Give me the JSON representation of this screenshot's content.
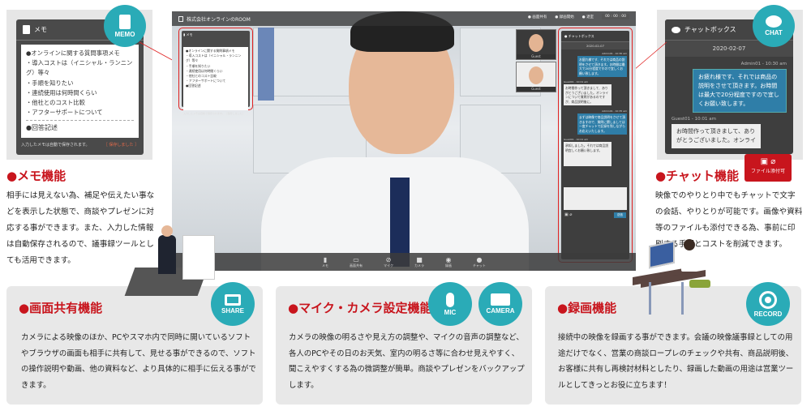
{
  "memo_panel": {
    "header": "メモ",
    "badge": "MEMO",
    "lines": [
      "●オンラインに関する質問事項メモ",
      "・導入コストは（イニシャル・ランニング）等々",
      "・手順を知りたい",
      "・連続使用は何時間くらい",
      "・他社とのコスト比較",
      "・アフターサポートについて"
    ],
    "answer_heading": "●回答記述",
    "autosave_note": "入力したメモは自動で保存されます。",
    "saved_status": "［ 保存しました ］"
  },
  "memo_feature": {
    "title": "●メモ機能",
    "text": "相手には見えない為、補足や伝えたい事などを表示した状態で、商談やプレゼンに対応する事ができます。また、入力した情報は自動保存されるので、議事録ツールとしても活用できます。"
  },
  "chat_panel": {
    "header": "チャットボックス",
    "badge": "CHAT",
    "date": "2020-02-07",
    "messages": [
      {
        "sender": "Admin01",
        "time": "10:30 am",
        "role": "admin",
        "text": "お疲れ様です、それでは商品の説明をさせて頂きます。お時間は最大で20分程度ですので宜しくお願い致します。"
      },
      {
        "sender": "Guest01",
        "time": "10:01 am",
        "role": "guest",
        "text": "お時間作って頂きまして、ありがとうございました。オンライ"
      }
    ]
  },
  "chat_feature": {
    "title": "●チャット機能",
    "file_badge": "ファイル添付可",
    "text": "映像でのやりとり中でもチャットで文字の会話、やりとりが可能です。画像や資料等のファイルも添付できる為、事前に印刷する手間とコストを削減できます。"
  },
  "video_app": {
    "title": "株式会社オンラインのROOM",
    "top_controls": [
      "画面共有",
      "録画開始",
      "退室",
      "00 : 00 : 00"
    ],
    "thumbnails": [
      {
        "label": "Guest"
      },
      {
        "label": "Guest"
      }
    ],
    "toolbar": [
      {
        "icon": "memo-icon",
        "label": "メモ"
      },
      {
        "icon": "screen-share-icon",
        "label": "画面共有"
      },
      {
        "icon": "mic-off-icon",
        "label": "マイク"
      },
      {
        "icon": "camera-icon",
        "label": "カメラ"
      },
      {
        "icon": "record-icon",
        "label": "録画"
      },
      {
        "icon": "chat-icon",
        "label": "チャット"
      }
    ],
    "mini_memo": {
      "header": "メモ",
      "lines": [
        "●オンラインに関する質問事項メモ",
        "・導入コストは（イニシャル・ランニング）等々",
        "・手順を知りたい",
        "・連続使用は何時間くらい",
        "・他社とのコスト比較",
        "・アフターサポートについて",
        "●回答記述"
      ],
      "footer": "入力したメモは自動で保存されます。 ［保存しました］"
    },
    "mini_chat": {
      "header": "チャットボックス",
      "date": "2020-02-07",
      "messages": [
        {
          "meta": "Admin01 - 10:30 am",
          "role": "admin",
          "text": "お疲れ様です、それでは商品の説明をさせて頂きます。お時間は最大で20分程度ですので宜しくお願い致します。"
        },
        {
          "meta": "Guest01 - 10:01 am",
          "role": "guest",
          "text": "お時間作って頂きまして、ありがとうございました。オンラインについて質問があるのですが、商品説明後に。"
        },
        {
          "meta": "Admin01 - 10:35 am",
          "role": "admin",
          "text": "まずは映像で商品説明をさせて頂きますので、質問に関しましては一度チャットで記録を残しながらお応えいたします。"
        },
        {
          "meta": "Guest01 - 10:01 am",
          "role": "guest",
          "text": "承知しました。それでは商品説明宜しくお願い致します。"
        }
      ],
      "send_label": "送信"
    }
  },
  "share_feature": {
    "title": "●画面共有機能",
    "badge": "SHARE",
    "text": "カメラによる映像のほか、PCやスマホ内で同時に開いているソフトやブラウザの画面も相手に共有して、見せる事ができるので、ソフトの操作説明や動画、他の資料など、より具体的に相手に伝える事ができます。"
  },
  "mic_camera_feature": {
    "title": "●マイク・カメラ設定機能",
    "badges": [
      "MIC",
      "CAMERA"
    ],
    "text": "カメラの映像の明るさや見え方の調整や、マイクの音声の調整など、各人のPCやその日のお天気、室内の明るさ等に合わせ見えやすく、聞こえやすくする為の微調整が簡単。商談やプレゼンをバックアップします。"
  },
  "record_feature": {
    "title": "●録画機能",
    "badge": "RECORD",
    "text": "接続中の映像を録画する事ができます。会議の映像議事録としての用途だけでなく、営業の商談ロープレのチェックや共有、商品説明後、お客様に共有し再検討材料としたり、録画した動画の用途は営業ツールとしてきっとお役に立ちます！"
  },
  "colors": {
    "accent_red": "#c8151d",
    "teal": "#2aabb7",
    "panel_dark": "#4a4a4a",
    "chat_blue": "#2f7ea8"
  }
}
